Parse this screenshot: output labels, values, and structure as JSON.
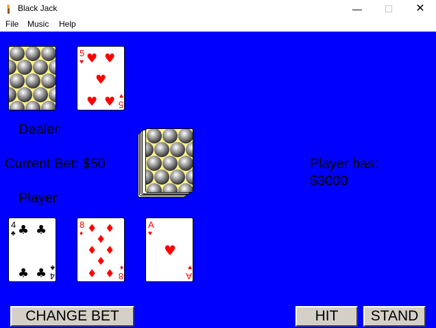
{
  "window": {
    "title": "Black Jack",
    "minimize": "—",
    "maximize": "☐",
    "close": "✕"
  },
  "menu": [
    {
      "label": "File"
    },
    {
      "label": "Music"
    },
    {
      "label": "Help"
    }
  ],
  "table": {
    "background": "#0000ff",
    "dealer_label": "Dealer",
    "player_label": "Player",
    "current_bet": "Current Bet: $50",
    "player_has_line1": "Player has:",
    "player_has_line2": "$3000"
  },
  "dealer_cards": [
    {
      "face_down": true
    },
    {
      "rank": "5",
      "suit": "hearts",
      "suit_symbol": "♥",
      "color": "#ff0000"
    }
  ],
  "player_cards": [
    {
      "rank": "4",
      "suit": "clubs",
      "suit_symbol": "♣",
      "color": "#000000"
    },
    {
      "rank": "8",
      "suit": "diamonds",
      "suit_symbol": "♦",
      "color": "#ff0000"
    },
    {
      "rank": "A",
      "suit": "hearts",
      "suit_symbol": "♥",
      "color": "#ff0000"
    }
  ],
  "deck": {
    "face_down": true
  },
  "buttons": {
    "change_bet": "CHANGE BET",
    "hit": "HIT",
    "stand": "STAND"
  }
}
